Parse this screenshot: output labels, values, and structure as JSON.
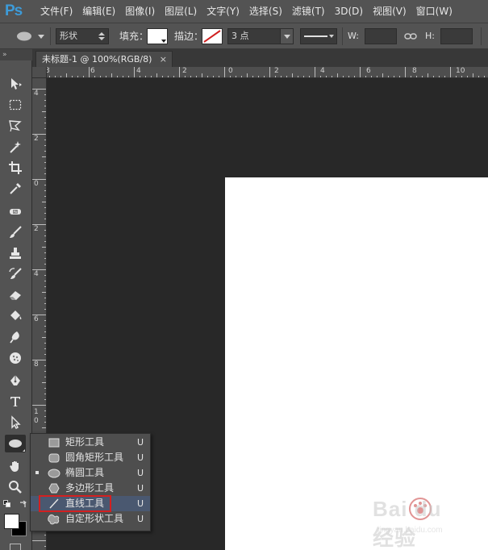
{
  "app": {
    "logo": "Ps"
  },
  "menubar": {
    "items": [
      "文件(F)",
      "编辑(E)",
      "图像(I)",
      "图层(L)",
      "文字(Y)",
      "选择(S)",
      "滤镜(T)",
      "3D(D)",
      "视图(V)",
      "窗口(W)"
    ]
  },
  "options": {
    "mode": "形状",
    "fill_label": "填充：",
    "stroke_label": "描边：",
    "stroke_width": "3 点",
    "w_label": "W:",
    "h_label": "H:"
  },
  "document": {
    "tab_title": "未标题-1 @ 100%(RGB/8)",
    "close": "×"
  },
  "rulers": {
    "top": [
      "8",
      "6",
      "4",
      "2",
      "0",
      "2",
      "4",
      "6",
      "8",
      "10"
    ],
    "left": [
      "4",
      "2",
      "0",
      "2",
      "4",
      "6",
      "8",
      "1\n0"
    ]
  },
  "flyout": {
    "items": [
      {
        "label": "矩形工具",
        "key": "U",
        "icon": "rectangle-icon"
      },
      {
        "label": "圆角矩形工具",
        "key": "U",
        "icon": "rounded-rectangle-icon"
      },
      {
        "label": "椭圆工具",
        "key": "U",
        "icon": "ellipse-icon",
        "current": true
      },
      {
        "label": "多边形工具",
        "key": "U",
        "icon": "polygon-icon"
      },
      {
        "label": "直线工具",
        "key": "U",
        "icon": "line-icon",
        "hovered": true
      },
      {
        "label": "自定形状工具",
        "key": "U",
        "icon": "custom-shape-icon"
      }
    ]
  },
  "colors": {
    "foreground": "#ffffff",
    "background": "#000000",
    "highlight_border": "#d32020",
    "ps_blue": "#3d9bd9"
  },
  "watermark": {
    "text": "Bai du 经验",
    "url": "jingyan.baidu.com"
  }
}
